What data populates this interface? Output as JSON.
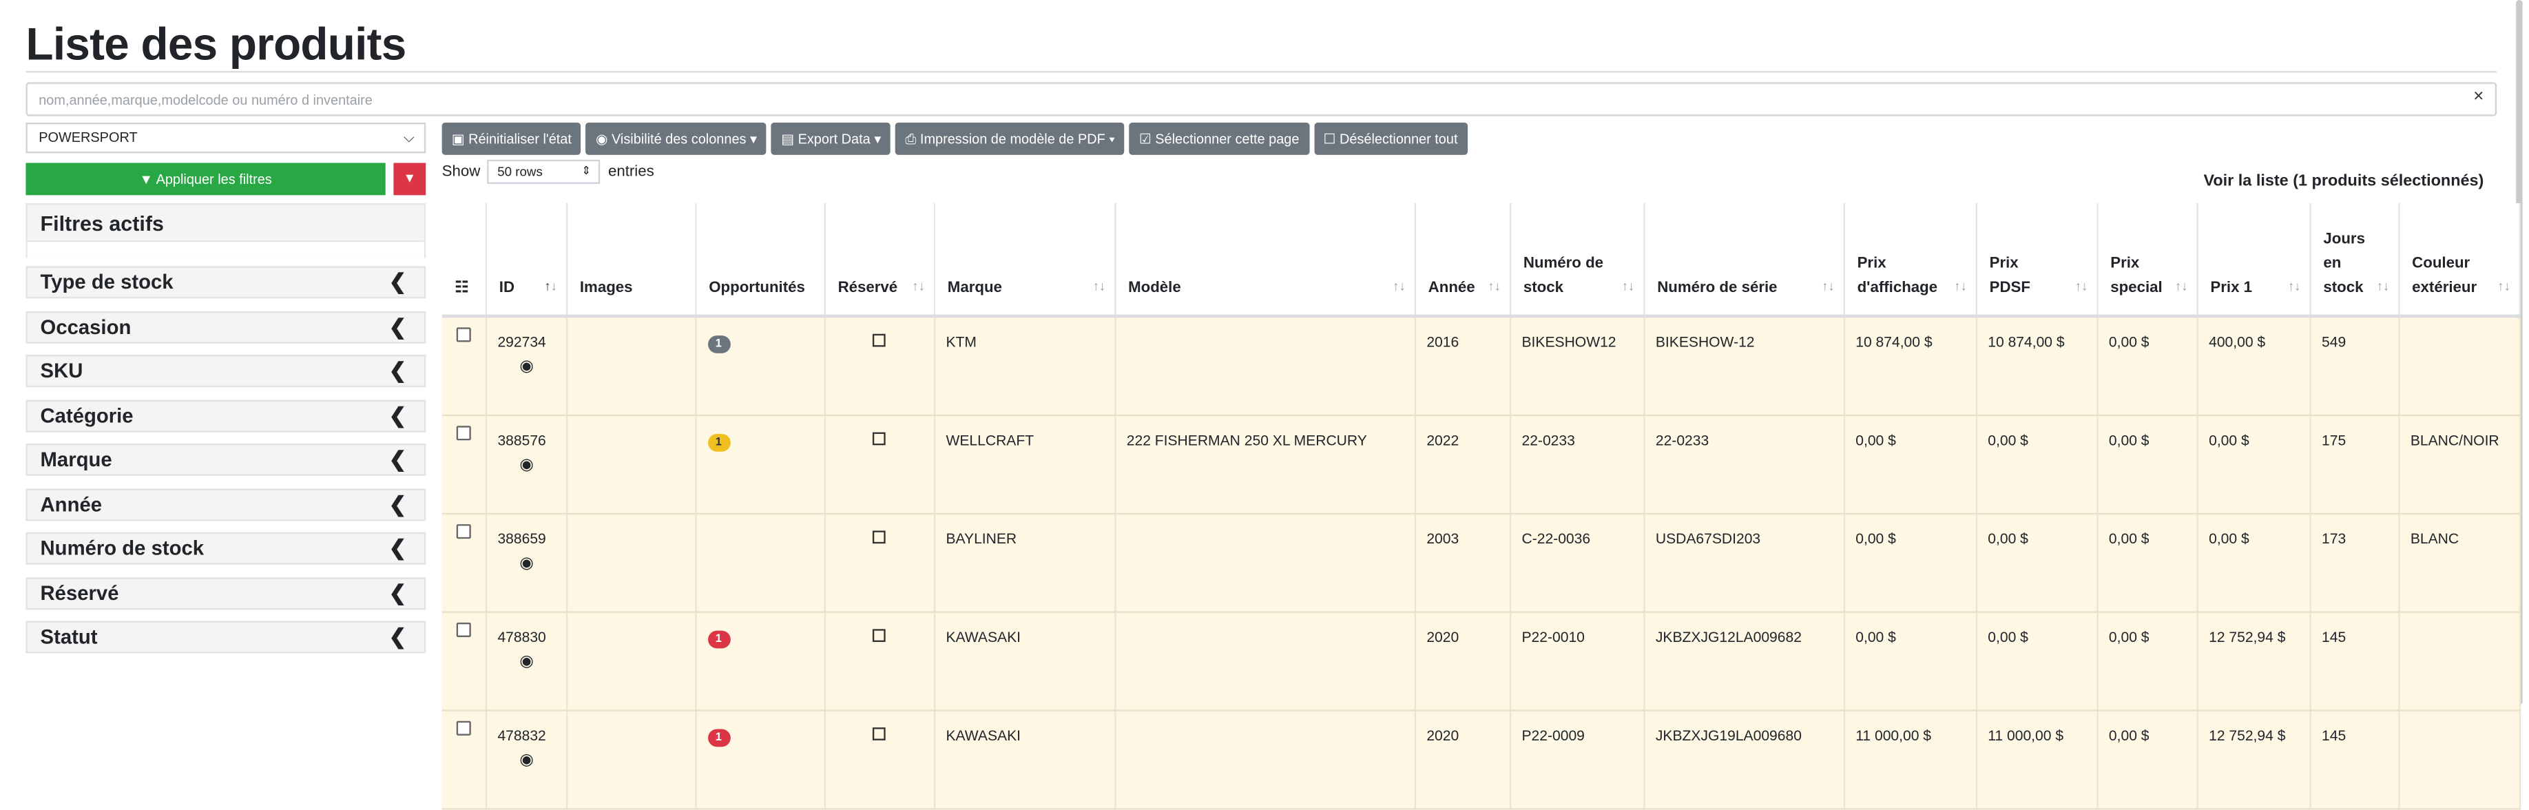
{
  "page": {
    "title": "Liste des produits"
  },
  "search": {
    "placeholder": "nom,année,marque,modelcode ou numéro d inventaire",
    "clear_icon": "×"
  },
  "sidebar": {
    "category_select": "POWERSPORT",
    "apply_button": "Appliquer les filtres",
    "active_filters_label": "Filtres actifs",
    "filters": [
      {
        "label": "Type de stock"
      },
      {
        "label": "Occasion"
      },
      {
        "label": "SKU"
      },
      {
        "label": "Catégorie"
      },
      {
        "label": "Marque"
      },
      {
        "label": "Année"
      },
      {
        "label": "Numéro de stock"
      },
      {
        "label": "Réservé"
      },
      {
        "label": "Statut"
      }
    ],
    "collapse_glyph": "❮"
  },
  "toolbar": {
    "reset": "Réinitialiser l'état",
    "columns": "Visibilité des colonnes",
    "export": "Export Data",
    "print": "Impression de modèle de PDF",
    "select_page": "Sélectionner cette page",
    "deselect_all": "Désélectionner tout"
  },
  "length": {
    "show": "Show",
    "value": "50 rows",
    "entries": "entries"
  },
  "list_info": "Voir la liste (1 produits sélectionnés)",
  "table": {
    "headers": {
      "id": "ID",
      "images": "Images",
      "opportunities": "Opportunités",
      "reserved": "Réservé",
      "brand": "Marque",
      "model": "Modèle",
      "year": "Année",
      "stock_no_1": "Numéro de",
      "stock_no_2": "stock",
      "serial": "Numéro de série",
      "display_price_1": "Prix",
      "display_price_2": "d'affichage",
      "pdsf_1": "Prix",
      "pdsf_2": "PDSF",
      "special_1": "Prix",
      "special_2": "special",
      "price1": "Prix 1",
      "days_1": "Jours",
      "days_2": "en",
      "days_3": "stock",
      "color_1": "Couleur",
      "color_2": "extérieur"
    },
    "rows": [
      {
        "id": "292734",
        "opp": "1",
        "opp_color": "grey",
        "brand": "KTM",
        "model": "",
        "year": "2016",
        "stock": "BIKESHOW12",
        "serial": "BIKESHOW-12",
        "display_price": "10 874,00 $",
        "pdsf": "10 874,00 $",
        "special": "0,00 $",
        "price1": "400,00 $",
        "days": "549",
        "color": ""
      },
      {
        "id": "388576",
        "opp": "1",
        "opp_color": "yellow",
        "brand": "WELLCRAFT",
        "model": "222 FISHERMAN 250 XL MERCURY",
        "year": "2022",
        "stock": "22-0233",
        "serial": "22-0233",
        "display_price": "0,00 $",
        "pdsf": "0,00 $",
        "special": "0,00 $",
        "price1": "0,00 $",
        "days": "175",
        "color": "BLANC/NOIR"
      },
      {
        "id": "388659",
        "opp": "",
        "opp_color": "",
        "brand": "BAYLINER",
        "model": "",
        "year": "2003",
        "stock": "C-22-0036",
        "serial": "USDA67SDI203",
        "display_price": "0,00 $",
        "pdsf": "0,00 $",
        "special": "0,00 $",
        "price1": "0,00 $",
        "days": "173",
        "color": "BLANC"
      },
      {
        "id": "478830",
        "opp": "1",
        "opp_color": "red",
        "brand": "KAWASAKI",
        "model": "",
        "year": "2020",
        "stock": "P22-0010",
        "serial": "JKBZXJG12LA009682",
        "display_price": "0,00 $",
        "pdsf": "0,00 $",
        "special": "0,00 $",
        "price1": "12 752,94 $",
        "days": "145",
        "color": ""
      },
      {
        "id": "478832",
        "opp": "1",
        "opp_color": "red",
        "brand": "KAWASAKI",
        "model": "",
        "year": "2020",
        "stock": "P22-0009",
        "serial": "JKBZXJG19LA009680",
        "display_price": "11 000,00 $",
        "pdsf": "11 000,00 $",
        "special": "0,00 $",
        "price1": "12 752,94 $",
        "days": "145",
        "color": ""
      }
    ]
  }
}
